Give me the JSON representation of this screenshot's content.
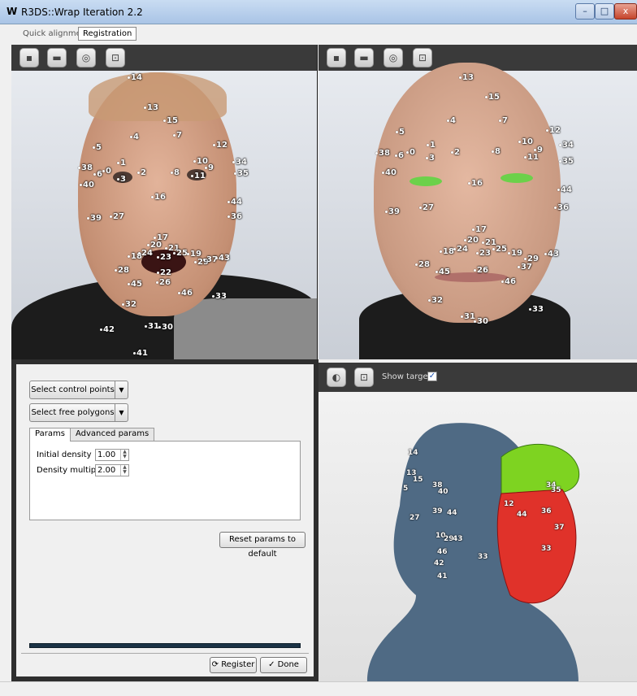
{
  "window": {
    "logo": "W",
    "title": "R3DS::Wrap Iteration 2.2",
    "minimize": "–",
    "maximize": "□",
    "close": "x"
  },
  "mode_tabs": [
    "Quick alignment",
    "Registration"
  ],
  "viewport_toolbar_icons": [
    "folder-icon",
    "save-icon",
    "center-icon",
    "fit-icon"
  ],
  "viewport_toolbar_glyphs": [
    "▪",
    "▬",
    "◎",
    "⊡"
  ],
  "landmarks_left": [
    "14",
    "13",
    "15",
    "7",
    "4",
    "5",
    "12",
    "34",
    "35",
    "38",
    "6",
    "0",
    "1",
    "3",
    "2",
    "8",
    "10",
    "9",
    "11",
    "40",
    "16",
    "44",
    "36",
    "39",
    "27",
    "17",
    "20",
    "21",
    "18",
    "24",
    "23",
    "25",
    "19",
    "29",
    "37",
    "43",
    "28",
    "22",
    "26",
    "45",
    "46",
    "33",
    "32",
    "31",
    "30",
    "42",
    "41"
  ],
  "landmarks_right": [
    "13",
    "15",
    "4",
    "7",
    "5",
    "12",
    "38",
    "6",
    "0",
    "1",
    "3",
    "2",
    "8",
    "10",
    "9",
    "11",
    "34",
    "35",
    "40",
    "16",
    "44",
    "36",
    "39",
    "27",
    "17",
    "20",
    "21",
    "18",
    "24",
    "23",
    "25",
    "19",
    "29",
    "43",
    "37",
    "28",
    "45",
    "26",
    "46",
    "32",
    "33",
    "31",
    "30"
  ],
  "landmarks_3d": [
    "14",
    "13",
    "15",
    "38",
    "5",
    "40",
    "12",
    "34",
    "35",
    "36",
    "39",
    "44",
    "27",
    "10",
    "29",
    "43",
    "46",
    "42",
    "41",
    "33",
    "37",
    "44",
    "33"
  ],
  "bottom_panel": {
    "select_control_points": "Select control points",
    "select_free_polygons": "Select free polygons",
    "tabs": [
      "Params",
      "Advanced params"
    ],
    "initial_density_label": "Initial density",
    "initial_density_value": "1.00",
    "density_multiplier_label": "Density multiplier",
    "density_multiplier_value": "2.00",
    "reset_button": "Reset params to default",
    "register_button": "Register",
    "done_button": "Done",
    "progress": 1.0
  },
  "view3d": {
    "show_target_label": "Show target",
    "show_target_checked": "✓",
    "toolbar_glyphs": [
      "◐",
      "⊡"
    ]
  },
  "colors": {
    "skin": "#d9a88d",
    "head_mesh": "#4f6a84",
    "target_green": "#7ed321",
    "target_red": "#e0322a",
    "eye_green": "#6cd14a"
  }
}
